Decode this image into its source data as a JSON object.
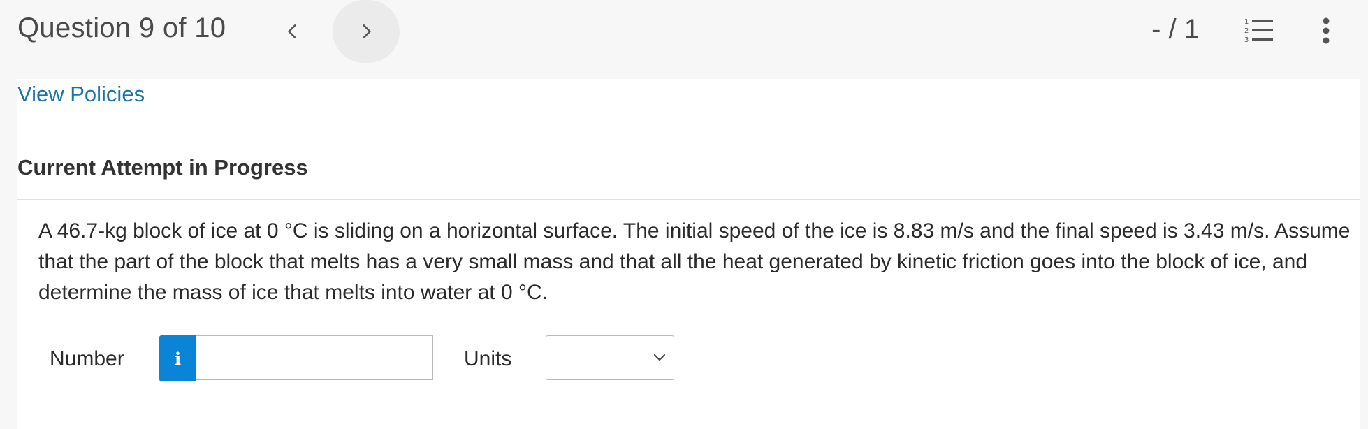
{
  "header": {
    "title": "Question 9 of 10",
    "prev_icon": "chevron-left-icon",
    "next_icon": "chevron-right-icon",
    "score": "- / 1",
    "list_icon": "numbered-list-icon",
    "list_icon_numbers": [
      "1",
      "2",
      "3"
    ],
    "more_icon": "vertical-ellipsis-icon"
  },
  "panel": {
    "policies_link": "View Policies",
    "attempt_heading": "Current Attempt in Progress",
    "question": "A 46.7-kg block of ice at 0 °C is sliding on a horizontal surface. The initial speed of the ice is 8.83 m/s and the final speed is 3.43 m/s. Assume that the part of the block that melts has a very small mass and that all the heat generated by kinetic friction goes into the block of ice, and determine the mass of ice that melts into water at 0 °C."
  },
  "answer": {
    "number_label": "Number",
    "info_glyph": "i",
    "number_value": "",
    "units_label": "Units",
    "units_selected": ""
  },
  "colors": {
    "accent": "#0a84d6",
    "link": "#1a73a8",
    "background": "#f7f7f7",
    "panel": "#ffffff"
  }
}
